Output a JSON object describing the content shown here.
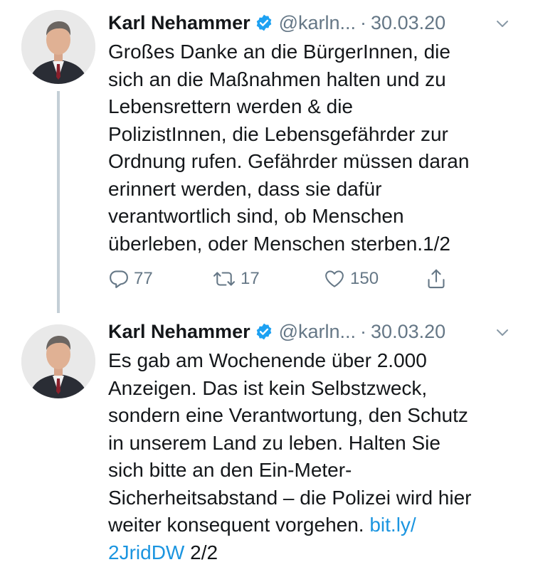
{
  "tweets": [
    {
      "author": {
        "name": "Karl Nehammer",
        "handle": "@karln...",
        "verified": true
      },
      "separator": "·",
      "date": "30.03.20",
      "lines": [
        "Großes Danke an die BürgerInnen, die",
        "sich an die Maßnahmen halten und zu",
        "Lebensrettern werden & die",
        "PolizistInnen, die Lebensgefährder zur",
        "Ordnung rufen. Gefährder müssen daran",
        "erinnert werden, dass sie dafür",
        "verantwortlich sind, ob Menschen",
        "überleben, oder Menschen sterben.1/2"
      ],
      "actions": {
        "replies": "77",
        "retweets": "17",
        "likes": "150"
      }
    },
    {
      "author": {
        "name": "Karl Nehammer",
        "handle": "@karln...",
        "verified": true
      },
      "separator": "·",
      "date": "30.03.20",
      "lines": [
        "Es gab am Wochenende über 2.000",
        "Anzeigen. Das ist kein Selbstzweck,",
        "sondern eine Verantwortung, den Schutz",
        "in unserem Land zu leben. Halten Sie",
        "sich bitte an den Ein-Meter-",
        "Sicherheitsabstand – die Polizei wird hier"
      ],
      "line7_text": "weiter konsequent vorgehen. ",
      "line7_link": "bit.ly/",
      "line8_link": "2JridDW",
      "line8_text": " 2/2"
    }
  ],
  "icons": [
    "verified-badge-icon",
    "chevron-down-icon",
    "reply-icon",
    "retweet-icon",
    "like-icon",
    "share-icon"
  ],
  "colors": {
    "link": "#1b95e0",
    "verified": "#1da1f2",
    "muted": "#657786",
    "text": "#14171a"
  }
}
